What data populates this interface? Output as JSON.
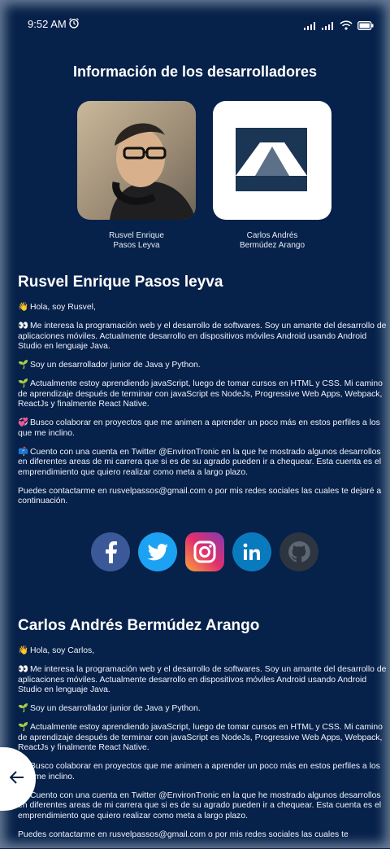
{
  "status_bar": {
    "time": "9:52 AM",
    "icons": [
      "alarm-icon",
      "signal-icon",
      "signal-icon",
      "wifi-icon",
      "battery-icon"
    ]
  },
  "page_title": "Información de los desarrolladores",
  "developers": [
    {
      "name_line1": "Rusvel Enrique",
      "name_line2": "Pasos Leyva"
    },
    {
      "name_line1": "Carlos Andrés",
      "name_line2": "Bermúdez Arango"
    }
  ],
  "section1": {
    "heading": "Rusvel Enrique Pasos leyva",
    "p1": "Hola, soy Rusvel,",
    "p2": "Me interesa la programación web y el desarrollo de softwares. Soy un amante del desarrollo de aplicaciones móviles. Actualmente desarrollo en dispositivos móviles Android usando Android Studio en lenguaje Java.",
    "p3": "Soy un desarrollador junior de Java y Python.",
    "p4": "Actualmente estoy aprendiendo javaScript, luego de tomar cursos en HTML y CSS. Mi camino de aprendizaje después de terminar con javaScript es NodeJs, Progressive Web Apps, Webpack, ReactJs y finalmente React Native.",
    "p5": "Busco colaborar en proyectos que me animen a aprender un poco más en estos perfiles a los que me inclino.",
    "p6": "Cuento con una cuenta en Twitter @EnvironTronic en la que he mostrado algunos desarrollos en diferentes areas de mi carrera que si es de su agrado pueden ir a chequear. Esta cuenta es el emprendimiento que quiero realizar como meta a largo plazo.",
    "p7": "Puedes contactarme en rusvelpassos@gmail.com o por mis redes sociales las cuales te dejaré a continuación."
  },
  "socials": [
    "facebook-icon",
    "twitter-icon",
    "instagram-icon",
    "linkedin-icon",
    "github-icon"
  ],
  "section2": {
    "heading": "Carlos Andrés Bermúdez Arango",
    "p1": "Hola, soy Carlos,",
    "p2": "Me interesa la programación web y el desarrollo de softwares. Soy un amante del desarrollo de aplicaciones móviles. Actualmente desarrollo en dispositivos móviles Android usando Android Studio en lenguaje Java.",
    "p3": "Soy un desarrollador junior de Java y Python.",
    "p4": "Actualmente estoy aprendiendo javaScript, luego de tomar cursos en HTML y CSS. Mi camino de aprendizaje después de terminar con javaScript es NodeJs, Progressive Web Apps, Webpack, ReactJs y finalmente React Native.",
    "p5": "Busco colaborar en proyectos que me animen a aprender un poco más en estos perfiles a los que me inclino.",
    "p6": "Cuento con una cuenta en Twitter @EnvironTronic en la que he mostrado algunos desarrollos en diferentes areas de mi carrera que si es de su agrado pueden ir a chequear. Esta cuenta es el emprendimiento que quiero realizar como meta a largo plazo.",
    "p7": "Puedes contactarme en rusvelpassos@gmail.com o por mis redes sociales las cuales te"
  },
  "colors": {
    "background": "#06214a",
    "logo_dark": "#1b3554",
    "logo_mid": "#5c7189"
  }
}
